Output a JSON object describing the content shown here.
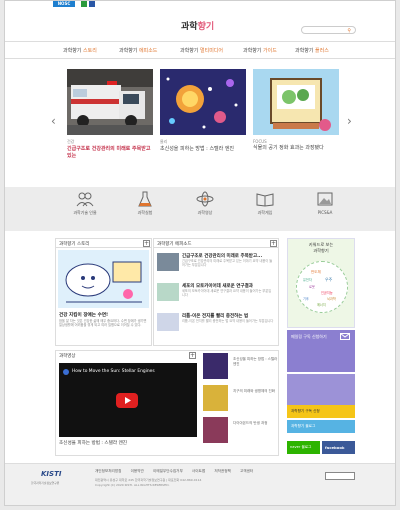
{
  "topbar": {
    "org_label": "NOSC",
    "colors": {
      "org": "#1f7fcf",
      "sq1": "#2b9a3c",
      "sq2": "#2a57a6"
    }
  },
  "header": {
    "logo_a": "과학",
    "logo_b": "향기",
    "search_placeholder": ""
  },
  "nav": [
    {
      "a": "과학향기 ",
      "b": "스토리"
    },
    {
      "a": "과학향기 ",
      "b": "에피소드"
    },
    {
      "a": "과학향기 ",
      "b": "멀티미디어"
    },
    {
      "a": "과학향기 ",
      "b": "가이드"
    },
    {
      "a": "과학향기 ",
      "b": "플러스"
    }
  ],
  "slider": {
    "prev": "‹",
    "next": "›",
    "cards": [
      {
        "cat": "건강",
        "title": "긴급구조로 건강관리의 미래로 주목받고 있는"
      },
      {
        "cat": "물리",
        "title": "초신성을 피하는 방법 : 스텔라 엔진"
      },
      {
        "cat": "FOCUS",
        "title": "식물의 공기 정화 효과는 과장됐다"
      }
    ]
  },
  "iconbar": [
    {
      "icon": "people-icon",
      "label": "과학기술 인물"
    },
    {
      "icon": "flask-icon",
      "label": "과학실험"
    },
    {
      "icon": "atom-icon",
      "label": "과학영상"
    },
    {
      "icon": "book-icon",
      "label": "과학게임"
    },
    {
      "icon": "photo-icon",
      "label": "PICS&A"
    }
  ],
  "story": {
    "head": "과학향기 스토리",
    "caption": "건강 지킴이 장애는 수면!",
    "desc": "잠을 잘 자는 것은 건강한 삶에 매우 중요하다. 수면 장애가 생기면 일상생활에 어려움을 겪게 되고 여러 질병으로 이어질 수 있다."
  },
  "episode": {
    "head": "과학향기 에피소드",
    "items": [
      {
        "title": "긴급구조로 건강관리의 미래로 주목받고...",
        "desc": "긴급구조로 건강관리의 미래로 주목받고 있는 이야기 요약 내용이 들어가는 부분입니다"
      },
      {
        "title": "세포의 모토카이어데 새로운 연구결과",
        "desc": "세포의 모토카이어데 새로운 연구결과 요약 내용이 들어가는 부분입니다"
      },
      {
        "title": "리튬-이온 전지를 빨리 충전하는 법",
        "desc": "리튬-이온 전지를 빨리 충전하는 법 요약 내용이 들어가는 부분입니다"
      }
    ]
  },
  "side": {
    "keyword_title": "키워드로 보는",
    "keyword_sub": "과학향기",
    "cloud": [
      "반도체",
      "유전자",
      "우주",
      "로봇",
      "인공지능",
      "기후",
      "에너지",
      "뇌과학"
    ],
    "sub_title": "메일링 구독 신청하기",
    "btn1": "과학향기 구독 신청",
    "btn2": "과학향기 블로그",
    "sns1": "naver 블로그",
    "sns2": "facebook"
  },
  "video": {
    "head": "과학영상",
    "player_title": "How to Move the Sun: Stellar Engines",
    "caption": "초신성을 피하는 방법 : 스텔라 엔진",
    "items": [
      {
        "text": "초신성을 피하는 방법 : 스텔라 엔진"
      },
      {
        "text": "지구의 미래와 생명체의 진화"
      },
      {
        "text": "다이아몬드의 탄생 과정"
      }
    ]
  },
  "footer": {
    "org": "KISTI",
    "org_sub": "한국과학기술정보연구원",
    "links": [
      "개인정보처리방침",
      "이용약관",
      "이메일무단수집거부",
      "사이트맵",
      "저작권정책",
      "고객센터"
    ],
    "address": "대전광역시 유성구 대학로 245 한국과학기술정보연구원 | 대표전화 042-869-0114",
    "copyright": "Copyright (C) 2020 KISTI. ALL RIGHTS RESERVED."
  }
}
